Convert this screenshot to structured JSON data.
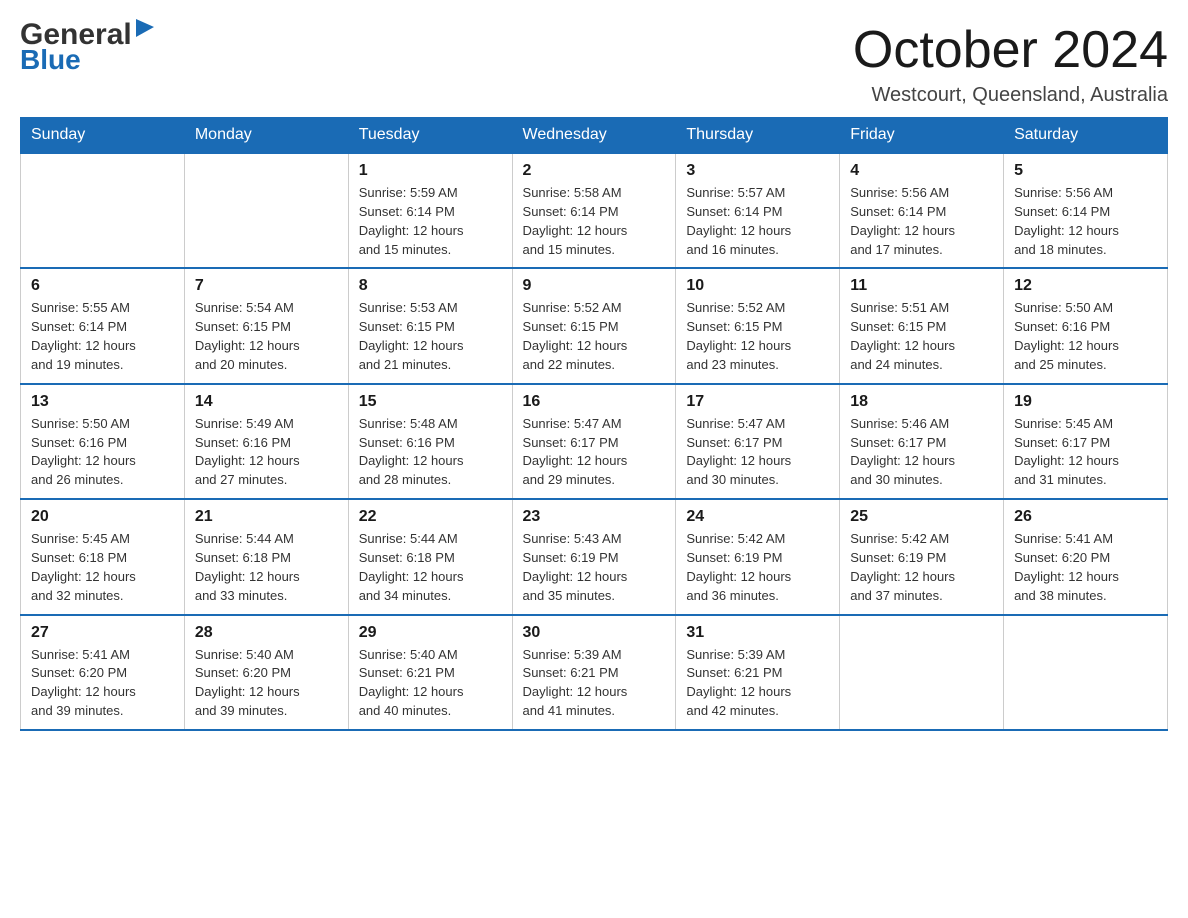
{
  "header": {
    "logo_general": "General",
    "logo_blue": "Blue",
    "month_title": "October 2024",
    "location": "Westcourt, Queensland, Australia"
  },
  "calendar": {
    "headers": [
      "Sunday",
      "Monday",
      "Tuesday",
      "Wednesday",
      "Thursday",
      "Friday",
      "Saturday"
    ],
    "rows": [
      [
        {
          "day": "",
          "info": ""
        },
        {
          "day": "",
          "info": ""
        },
        {
          "day": "1",
          "info": "Sunrise: 5:59 AM\nSunset: 6:14 PM\nDaylight: 12 hours\nand 15 minutes."
        },
        {
          "day": "2",
          "info": "Sunrise: 5:58 AM\nSunset: 6:14 PM\nDaylight: 12 hours\nand 15 minutes."
        },
        {
          "day": "3",
          "info": "Sunrise: 5:57 AM\nSunset: 6:14 PM\nDaylight: 12 hours\nand 16 minutes."
        },
        {
          "day": "4",
          "info": "Sunrise: 5:56 AM\nSunset: 6:14 PM\nDaylight: 12 hours\nand 17 minutes."
        },
        {
          "day": "5",
          "info": "Sunrise: 5:56 AM\nSunset: 6:14 PM\nDaylight: 12 hours\nand 18 minutes."
        }
      ],
      [
        {
          "day": "6",
          "info": "Sunrise: 5:55 AM\nSunset: 6:14 PM\nDaylight: 12 hours\nand 19 minutes."
        },
        {
          "day": "7",
          "info": "Sunrise: 5:54 AM\nSunset: 6:15 PM\nDaylight: 12 hours\nand 20 minutes."
        },
        {
          "day": "8",
          "info": "Sunrise: 5:53 AM\nSunset: 6:15 PM\nDaylight: 12 hours\nand 21 minutes."
        },
        {
          "day": "9",
          "info": "Sunrise: 5:52 AM\nSunset: 6:15 PM\nDaylight: 12 hours\nand 22 minutes."
        },
        {
          "day": "10",
          "info": "Sunrise: 5:52 AM\nSunset: 6:15 PM\nDaylight: 12 hours\nand 23 minutes."
        },
        {
          "day": "11",
          "info": "Sunrise: 5:51 AM\nSunset: 6:15 PM\nDaylight: 12 hours\nand 24 minutes."
        },
        {
          "day": "12",
          "info": "Sunrise: 5:50 AM\nSunset: 6:16 PM\nDaylight: 12 hours\nand 25 minutes."
        }
      ],
      [
        {
          "day": "13",
          "info": "Sunrise: 5:50 AM\nSunset: 6:16 PM\nDaylight: 12 hours\nand 26 minutes."
        },
        {
          "day": "14",
          "info": "Sunrise: 5:49 AM\nSunset: 6:16 PM\nDaylight: 12 hours\nand 27 minutes."
        },
        {
          "day": "15",
          "info": "Sunrise: 5:48 AM\nSunset: 6:16 PM\nDaylight: 12 hours\nand 28 minutes."
        },
        {
          "day": "16",
          "info": "Sunrise: 5:47 AM\nSunset: 6:17 PM\nDaylight: 12 hours\nand 29 minutes."
        },
        {
          "day": "17",
          "info": "Sunrise: 5:47 AM\nSunset: 6:17 PM\nDaylight: 12 hours\nand 30 minutes."
        },
        {
          "day": "18",
          "info": "Sunrise: 5:46 AM\nSunset: 6:17 PM\nDaylight: 12 hours\nand 30 minutes."
        },
        {
          "day": "19",
          "info": "Sunrise: 5:45 AM\nSunset: 6:17 PM\nDaylight: 12 hours\nand 31 minutes."
        }
      ],
      [
        {
          "day": "20",
          "info": "Sunrise: 5:45 AM\nSunset: 6:18 PM\nDaylight: 12 hours\nand 32 minutes."
        },
        {
          "day": "21",
          "info": "Sunrise: 5:44 AM\nSunset: 6:18 PM\nDaylight: 12 hours\nand 33 minutes."
        },
        {
          "day": "22",
          "info": "Sunrise: 5:44 AM\nSunset: 6:18 PM\nDaylight: 12 hours\nand 34 minutes."
        },
        {
          "day": "23",
          "info": "Sunrise: 5:43 AM\nSunset: 6:19 PM\nDaylight: 12 hours\nand 35 minutes."
        },
        {
          "day": "24",
          "info": "Sunrise: 5:42 AM\nSunset: 6:19 PM\nDaylight: 12 hours\nand 36 minutes."
        },
        {
          "day": "25",
          "info": "Sunrise: 5:42 AM\nSunset: 6:19 PM\nDaylight: 12 hours\nand 37 minutes."
        },
        {
          "day": "26",
          "info": "Sunrise: 5:41 AM\nSunset: 6:20 PM\nDaylight: 12 hours\nand 38 minutes."
        }
      ],
      [
        {
          "day": "27",
          "info": "Sunrise: 5:41 AM\nSunset: 6:20 PM\nDaylight: 12 hours\nand 39 minutes."
        },
        {
          "day": "28",
          "info": "Sunrise: 5:40 AM\nSunset: 6:20 PM\nDaylight: 12 hours\nand 39 minutes."
        },
        {
          "day": "29",
          "info": "Sunrise: 5:40 AM\nSunset: 6:21 PM\nDaylight: 12 hours\nand 40 minutes."
        },
        {
          "day": "30",
          "info": "Sunrise: 5:39 AM\nSunset: 6:21 PM\nDaylight: 12 hours\nand 41 minutes."
        },
        {
          "day": "31",
          "info": "Sunrise: 5:39 AM\nSunset: 6:21 PM\nDaylight: 12 hours\nand 42 minutes."
        },
        {
          "day": "",
          "info": ""
        },
        {
          "day": "",
          "info": ""
        }
      ]
    ]
  }
}
